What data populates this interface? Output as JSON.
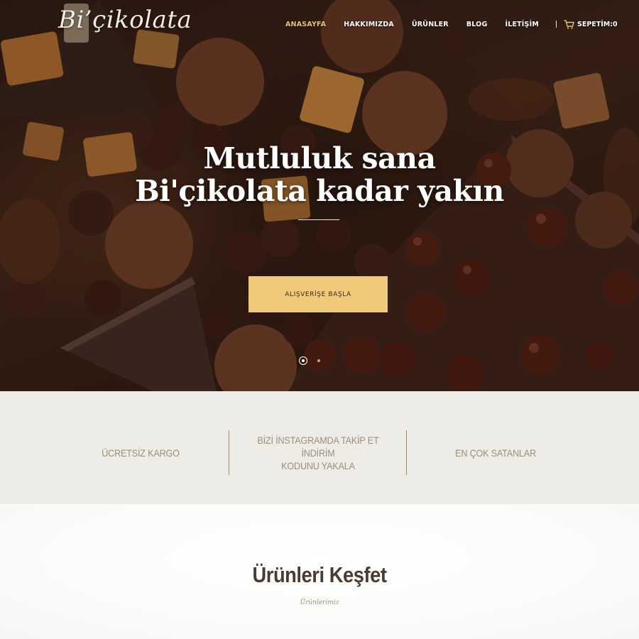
{
  "brand": {
    "logo_text": "Bi’çikolata"
  },
  "nav": {
    "items": [
      {
        "label": "ANASAYFA",
        "active": true
      },
      {
        "label": "HAKKIMIZDA",
        "active": false
      },
      {
        "label": "ÜRÜNLER",
        "active": false
      },
      {
        "label": "BLOG",
        "active": false
      },
      {
        "label": "İLETİŞİM",
        "active": false
      }
    ],
    "cart_label": "SEPETİM:0",
    "cart_icon": "shopping-cart-icon"
  },
  "hero": {
    "title_line1": "Mutluluk sana",
    "title_line2": "Bi'çikolata kadar yakın",
    "cta_label": "ALIŞVERİŞE BAŞLA",
    "slides": 2,
    "active_slide": 1
  },
  "features": [
    {
      "line1": "ÜCRETSİZ KARGO",
      "line2": ""
    },
    {
      "line1": "BİZİ İNSTAGRAMDA TAKİP ET İNDİRİM",
      "line2": "KODUNU YAKALA"
    },
    {
      "line1": "EN ÇOK SATANLAR",
      "line2": ""
    }
  ],
  "products": {
    "title": "Ürünleri Keşfet",
    "subtitle": "Ürünlerimiz"
  },
  "colors": {
    "accent": "#f0c97a",
    "active_nav": "#e9c270",
    "band_bg": "#eeece6",
    "feature_text": "#9b8f7a",
    "heading_text": "#4b3b30"
  }
}
